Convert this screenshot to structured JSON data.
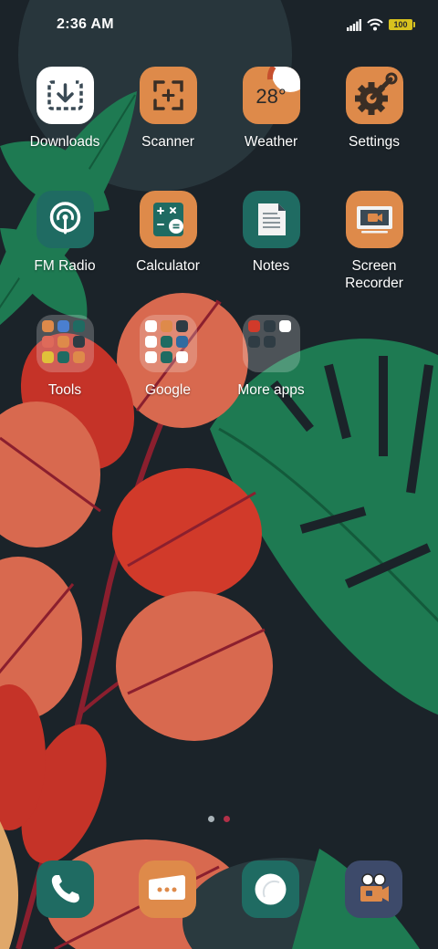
{
  "status_bar": {
    "time": "2:36 AM",
    "battery_level": "100",
    "icons": [
      "signal-icon",
      "wifi-icon",
      "battery-icon"
    ]
  },
  "apps": {
    "downloads": "Downloads",
    "scanner": "Scanner",
    "weather": "Weather",
    "weather_temp": "28°",
    "settings": "Settings",
    "fm_radio": "FM Radio",
    "calculator": "Calculator",
    "notes": "Notes",
    "screen_recorder_line1": "Screen",
    "screen_recorder_line2": "Recorder"
  },
  "folders": {
    "tools": "Tools",
    "google": "Google",
    "more_apps": "More apps"
  },
  "page_indicator": {
    "pages": 2,
    "current": 2
  },
  "dock": [
    "phone-icon",
    "messages-icon",
    "browser-icon",
    "camera-icon"
  ],
  "colors": {
    "background": "#1b2329",
    "accent_orange": "#de8a4a",
    "accent_teal": "#1f6b62",
    "active_dot": "#b23048",
    "battery": "#d8c21e"
  }
}
